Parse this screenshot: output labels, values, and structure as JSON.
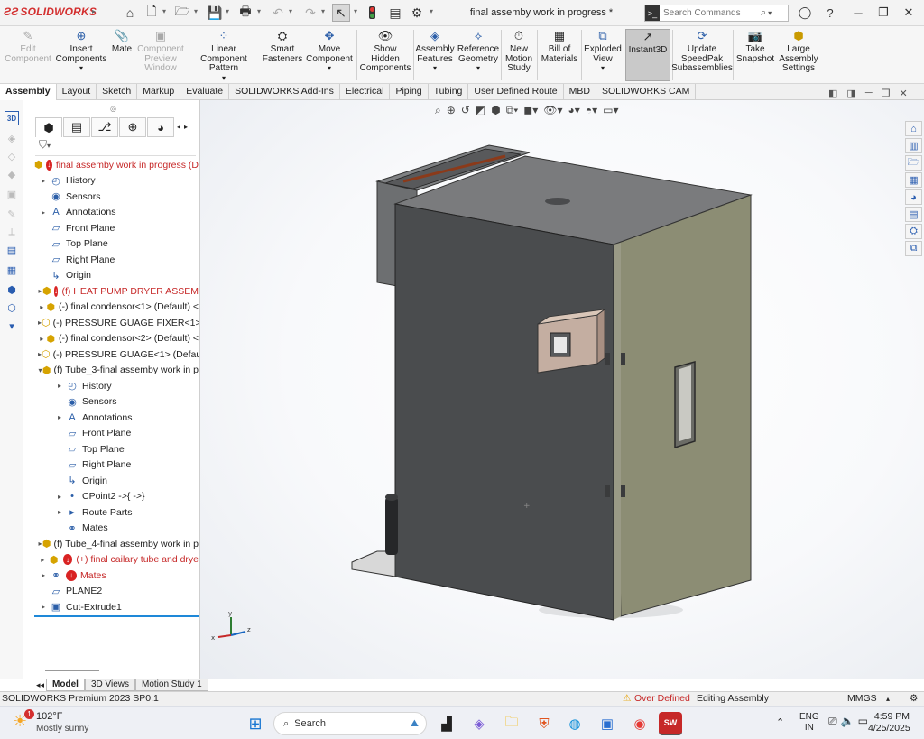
{
  "app": {
    "logo": "SOLIDWORKS",
    "document_title": "final assemby work in progress *",
    "search_placeholder": "Search Commands"
  },
  "command_manager": [
    {
      "label": "Edit Component",
      "enabled": false,
      "icon": "edit-component-icon"
    },
    {
      "label": "Insert Components",
      "enabled": true,
      "icon": "insert-components-icon"
    },
    {
      "label": "Mate",
      "enabled": true,
      "icon": "mate-icon"
    },
    {
      "label": "Component Preview Window",
      "enabled": false,
      "icon": "preview-window-icon"
    },
    {
      "label": "Linear Component Pattern",
      "enabled": true,
      "icon": "linear-pattern-icon"
    },
    {
      "label": "Smart Fasteners",
      "enabled": true,
      "icon": "smart-fasteners-icon"
    },
    {
      "label": "Move Component",
      "enabled": true,
      "icon": "move-component-icon"
    },
    {
      "label": "Show Hidden Components",
      "enabled": true,
      "icon": "show-hidden-icon"
    },
    {
      "label": "Assembly Features",
      "enabled": true,
      "icon": "assembly-features-icon"
    },
    {
      "label": "Reference Geometry",
      "enabled": true,
      "icon": "reference-geometry-icon"
    },
    {
      "label": "New Motion Study",
      "enabled": true,
      "icon": "motion-study-icon"
    },
    {
      "label": "Bill of Materials",
      "enabled": true,
      "icon": "bom-icon"
    },
    {
      "label": "Exploded View",
      "enabled": true,
      "icon": "exploded-view-icon"
    },
    {
      "label": "Instant3D",
      "enabled": true,
      "active": true,
      "icon": "instant3d-icon"
    },
    {
      "label": "Update SpeedPak Subassemblies",
      "enabled": true,
      "icon": "speedpak-icon"
    },
    {
      "label": "Take Snapshot",
      "enabled": true,
      "icon": "snapshot-icon"
    },
    {
      "label": "Large Assembly Settings",
      "enabled": true,
      "icon": "large-assembly-icon"
    }
  ],
  "tabs": [
    "Assembly",
    "Layout",
    "Sketch",
    "Markup",
    "Evaluate",
    "SOLIDWORKS Add-Ins",
    "Electrical",
    "Piping",
    "Tubing",
    "User Defined Route",
    "MBD",
    "SOLIDWORKS CAM"
  ],
  "active_tab": "Assembly",
  "tree": [
    {
      "label": "final assemby work in progress (D",
      "level": 0,
      "icon": "assembly-icon",
      "error": true,
      "red": true
    },
    {
      "label": "History",
      "level": 1,
      "expand": "closed",
      "icon": "history-icon"
    },
    {
      "label": "Sensors",
      "level": 1,
      "icon": "sensors-icon"
    },
    {
      "label": "Annotations",
      "level": 1,
      "expand": "closed",
      "icon": "annotations-icon"
    },
    {
      "label": "Front Plane",
      "level": 1,
      "icon": "plane-icon"
    },
    {
      "label": "Top Plane",
      "level": 1,
      "icon": "plane-icon"
    },
    {
      "label": "Right Plane",
      "level": 1,
      "icon": "plane-icon"
    },
    {
      "label": "Origin",
      "level": 1,
      "icon": "origin-icon"
    },
    {
      "label": "(f) HEAT PUMP DRYER ASSEM",
      "level": 1,
      "expand": "closed",
      "icon": "assembly-icon",
      "error": true,
      "red": true
    },
    {
      "label": "(-) final condensor<1> (Default) <",
      "level": 1,
      "expand": "closed",
      "icon": "assembly-icon"
    },
    {
      "label": "(-) PRESSURE GUAGE FIXER<1> (D",
      "level": 1,
      "expand": "closed",
      "icon": "part-icon"
    },
    {
      "label": "(-) final condensor<2> (Default) <",
      "level": 1,
      "expand": "closed",
      "icon": "assembly-icon"
    },
    {
      "label": "(-) PRESSURE GUAGE<1> (Default",
      "level": 1,
      "expand": "closed",
      "icon": "part-icon"
    },
    {
      "label": "(f) Tube_3-final assemby work in p",
      "level": 1,
      "expand": "open",
      "icon": "assembly-icon"
    },
    {
      "label": "History",
      "level": 2,
      "expand": "closed",
      "icon": "history-icon"
    },
    {
      "label": "Sensors",
      "level": 2,
      "icon": "sensors-icon"
    },
    {
      "label": "Annotations",
      "level": 2,
      "expand": "closed",
      "icon": "annotations-icon"
    },
    {
      "label": "Front Plane",
      "level": 2,
      "icon": "plane-icon"
    },
    {
      "label": "Top Plane",
      "level": 2,
      "icon": "plane-icon"
    },
    {
      "label": "Right Plane",
      "level": 2,
      "icon": "plane-icon"
    },
    {
      "label": "Origin",
      "level": 2,
      "icon": "origin-icon"
    },
    {
      "label": "CPoint2 ->{ ->}",
      "level": 2,
      "expand": "arrow",
      "icon": "point-icon"
    },
    {
      "label": "Route Parts",
      "level": 2,
      "expand": "closed",
      "icon": "folder-icon"
    },
    {
      "label": "Mates",
      "level": 2,
      "icon": "mates-icon"
    },
    {
      "label": "(f) Tube_4-final assemby work in p",
      "level": 1,
      "expand": "closed",
      "icon": "assembly-icon"
    },
    {
      "label": "(+) final cailary tube and drye",
      "level": 1,
      "expand": "closed",
      "icon": "assembly-icon",
      "error": true,
      "red": true
    },
    {
      "label": "Mates",
      "level": 1,
      "expand": "closed",
      "icon": "mates-icon",
      "error": true,
      "red": true
    },
    {
      "label": "PLANE2",
      "level": 1,
      "icon": "plane-icon"
    },
    {
      "label": "Cut-Extrude1",
      "level": 1,
      "expand": "closed",
      "icon": "cut-extrude-icon"
    }
  ],
  "model_tabs": [
    "Model",
    "3D Views",
    "Motion Study 1"
  ],
  "status": {
    "version": "SOLIDWORKS Premium 2023 SP0.1",
    "warning": "Over Defined",
    "mode": "Editing Assembly",
    "units": "MMGS"
  },
  "taskbar": {
    "weather_temp": "102°F",
    "weather_text": "Mostly sunny",
    "weather_badge": "1",
    "search_label": "Search",
    "lang": "ENG",
    "region": "IN",
    "time": "4:59 PM",
    "date": "4/25/2025"
  },
  "triad": {
    "x": "x",
    "y": "y",
    "z": "z"
  },
  "colors": {
    "accent": "#1e88d8",
    "error": "#d92323",
    "logo": "#d32f2f"
  }
}
